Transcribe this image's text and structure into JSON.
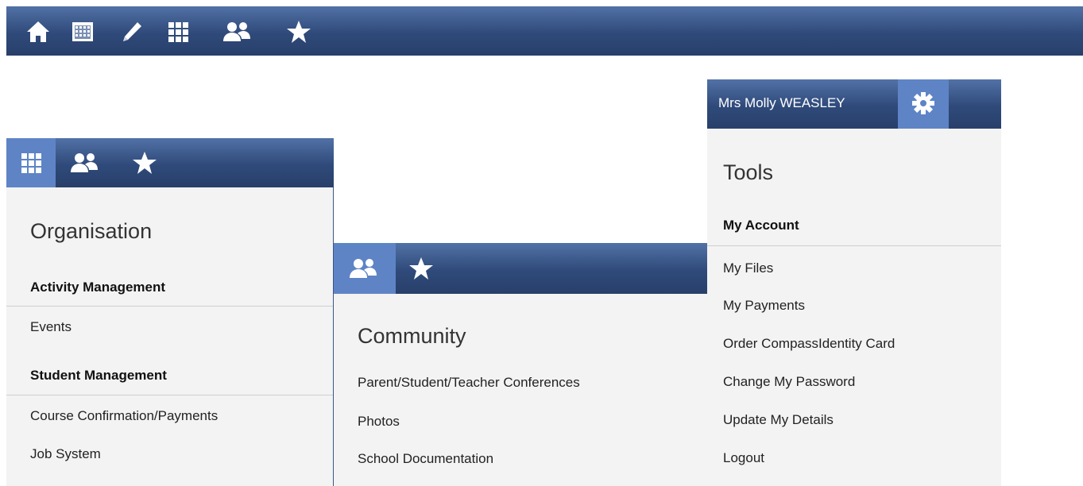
{
  "top_toolbar": {
    "icons": [
      "home-icon",
      "calendar-icon",
      "pencil-icon",
      "grid-icon",
      "people-icon",
      "star-icon"
    ]
  },
  "organisation_menu": {
    "title": "Organisation",
    "sections": [
      {
        "heading": "Activity Management",
        "items": [
          "Events"
        ]
      },
      {
        "heading": "Student Management",
        "items": [
          "Course Confirmation/Payments",
          "Job System"
        ]
      }
    ]
  },
  "community_menu": {
    "title": "Community",
    "items": [
      "Parent/Student/Teacher Conferences",
      "Photos",
      "School Documentation"
    ]
  },
  "user_menu": {
    "user_name": "Mrs Molly WEASLEY",
    "title": "Tools",
    "section_heading": "My Account",
    "items": [
      "My Files",
      "My Payments",
      "Order CompassIdentity Card",
      "Change My Password",
      "Update My Details",
      "Logout"
    ]
  },
  "colors": {
    "bar_top": "#5271a6",
    "bar_bottom": "#283f6a",
    "active_tile": "#5e84c6",
    "panel_bg": "#f3f3f3"
  }
}
